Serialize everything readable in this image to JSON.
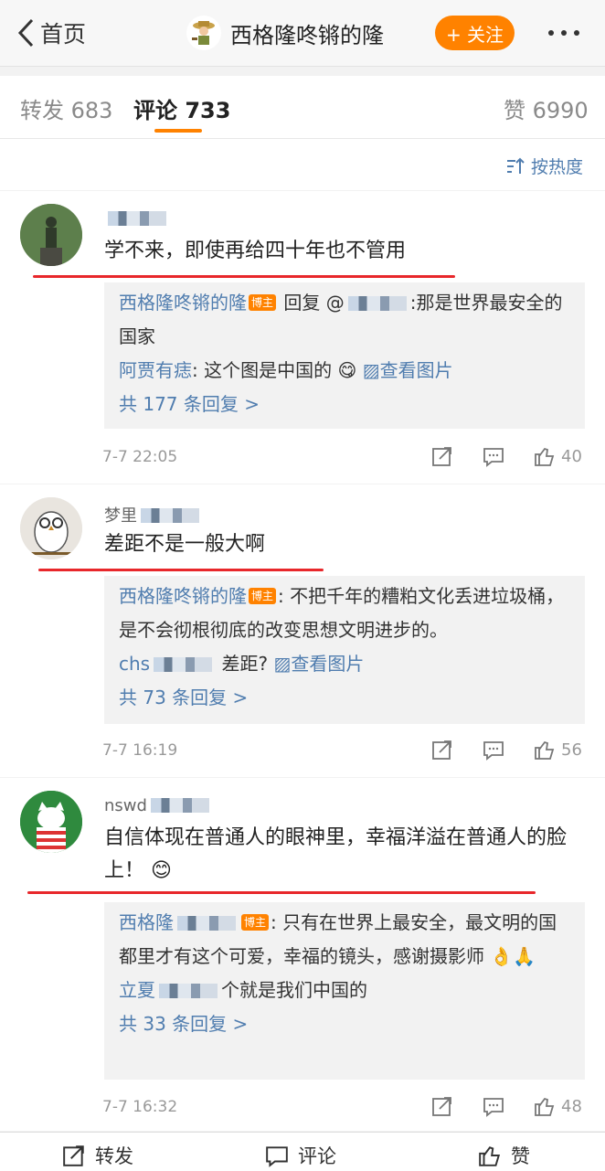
{
  "nav": {
    "back_label": "首页",
    "title": "西格隆咚锵的隆",
    "follow_label": "+ 关注"
  },
  "tabs": {
    "repost": "转发 683",
    "comment": "评论 733",
    "like": "赞 6990"
  },
  "sort_label": "按热度",
  "comments": [
    {
      "username": "",
      "text": "学不来，即使再给四十年也不管用",
      "reply_author": "西格隆咚锵的隆",
      "reply_badge": "博主",
      "reply_text_prefix": " 回复 @",
      "reply_text": ":那是世界最安全的国家",
      "sub_author": "阿贾有痣",
      "sub_text": ": 这个图是中国的",
      "view_image": "查看图片",
      "more_replies": "共 177 条回复 >",
      "time": "7-7 22:05",
      "likes": "40"
    },
    {
      "username": "梦里",
      "text": "差距不是一般大啊",
      "reply_author": "西格隆咚锵的隆",
      "reply_badge": "博主",
      "reply_text": ": 不把千年的糟粕文化丢进垃圾桶，是不会彻根彻底的改变思想文明进步的。",
      "sub_author": "chs",
      "sub_text": " 差距?",
      "view_image": "查看图片",
      "more_replies": "共 73 条回复 >",
      "time": "7-7 16:19",
      "likes": "56"
    },
    {
      "username": "nswd",
      "text": "自信体现在普通人的眼神里，幸福洋溢在普通人的脸上！",
      "reply_author": "西格隆",
      "reply_badge": "博主",
      "reply_text": ": 只有在世界上最安全，最文明的国都里才有这个可爱，幸福的镜头，感谢摄影师",
      "sub_author": "立夏",
      "sub_text": "个就是我们中国的",
      "more_replies": "共 33 条回复 >",
      "time": "7-7 16:32",
      "likes": "48"
    }
  ],
  "bottom": {
    "repost": "转发",
    "comment": "评论",
    "like": "赞"
  },
  "colors": {
    "accent": "#ff8200",
    "link": "#507daf",
    "underline": "#e8272b"
  }
}
